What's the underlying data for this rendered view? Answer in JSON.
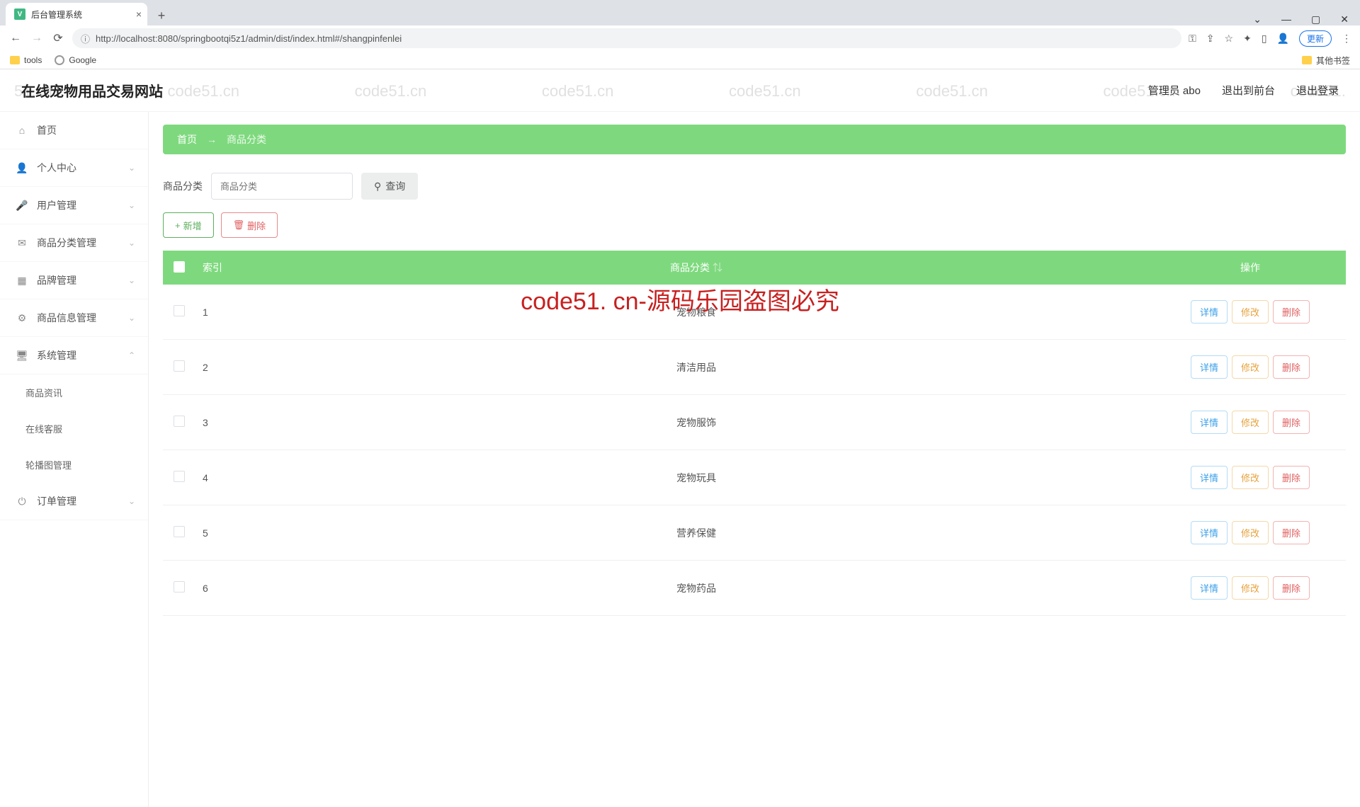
{
  "browser": {
    "tab_title": "后台管理系统",
    "url": "http://localhost:8080/springbootqi5z1/admin/dist/index.html#/shangpinfenlei",
    "update_label": "更新",
    "bookmarks": {
      "tools": "tools",
      "google": "Google",
      "others": "其他书签"
    }
  },
  "header": {
    "title": "在线宠物用品交易网站",
    "admin": "管理员 abo",
    "exit_front": "退出到前台",
    "logout": "退出登录"
  },
  "sidebar": {
    "home": "首页",
    "personal": "个人中心",
    "users": "用户管理",
    "cat_mgmt": "商品分类管理",
    "brand": "品牌管理",
    "product_info": "商品信息管理",
    "system": "系统管理",
    "news": "商品资讯",
    "service": "在线客服",
    "carousel": "轮播图管理",
    "orders": "订单管理"
  },
  "breadcrumb": {
    "home": "首页",
    "current": "商品分类"
  },
  "search": {
    "label": "商品分类",
    "placeholder": "商品分类",
    "button": "查询"
  },
  "actions": {
    "add": "新增",
    "delete": "删除"
  },
  "table": {
    "headers": {
      "index": "索引",
      "category": "商品分类",
      "ops": "操作"
    },
    "op_labels": {
      "detail": "详情",
      "edit": "修改",
      "delete": "删除"
    },
    "rows": [
      {
        "idx": "1",
        "cat": "宠物粮食"
      },
      {
        "idx": "2",
        "cat": "清洁用品"
      },
      {
        "idx": "3",
        "cat": "宠物服饰"
      },
      {
        "idx": "4",
        "cat": "宠物玩具"
      },
      {
        "idx": "5",
        "cat": "营养保健"
      },
      {
        "idx": "6",
        "cat": "宠物药品"
      }
    ]
  },
  "watermark": {
    "text": "code51.cn",
    "center": "code51. cn-源码乐园盗图必究"
  }
}
